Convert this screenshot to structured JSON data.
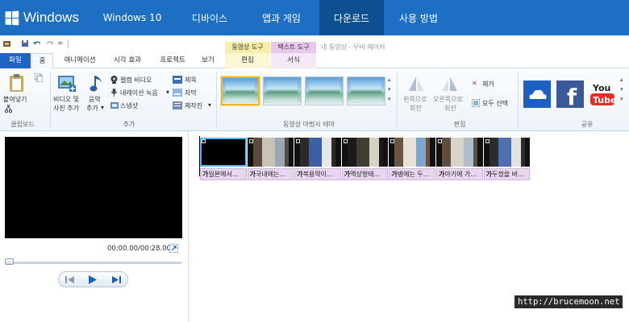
{
  "site_nav": {
    "brand": "Windows",
    "items": [
      {
        "label": "Windows 10"
      },
      {
        "label": "디바이스"
      },
      {
        "label": "앱과 게임"
      },
      {
        "label": "다운로드",
        "active": true
      },
      {
        "label": "사용 방법"
      }
    ],
    "color": "#1c6fc3",
    "active_color": "#0e4f92"
  },
  "app": {
    "contextual_video_tools": "동영상 도구",
    "contextual_text_tools": "텍스트 도구",
    "window_title": "내 동영상 - 무비 메이커",
    "qa_more": "="
  },
  "tabs": {
    "file": "파일",
    "home": "홈",
    "animation": "애니메이션",
    "visual_effects": "시각 효과",
    "project": "프로젝트",
    "view": "보기",
    "edit": "편집",
    "format": "서식"
  },
  "ribbon": {
    "clipboard": {
      "paste": "붙여넣기",
      "group": "클립보드"
    },
    "add": {
      "add_videos_line1": "비디오 및",
      "add_videos_line2": "사진 추가",
      "add_music_line1": "음악",
      "add_music_line2": "추가",
      "webcam": "웹캠 비디오",
      "narration": "내레이션 녹음",
      "snapshot": "스냅샷",
      "title": "제목",
      "caption": "자막",
      "credits": "제작진",
      "group": "추가"
    },
    "themes": {
      "group": "동영상 마법사 테마"
    },
    "editing": {
      "rotate_left_line1": "왼쪽으로",
      "rotate_left_line2": "회전",
      "rotate_right_line1": "오른쪽으로",
      "rotate_right_line2": "회전",
      "remove": "제거",
      "select_all": "모두 선택",
      "group": "편집"
    },
    "share": {
      "group": "공유",
      "youtube_line1": "You",
      "youtube_line2": "Tube"
    }
  },
  "preview": {
    "time": "00:00.00/00:28.00"
  },
  "storyboard": {
    "clips": [
      {
        "caption": "일본에서..."
      },
      {
        "caption": "국내에는..."
      },
      {
        "caption": "복용약이..."
      },
      {
        "caption": "액상형태..."
      },
      {
        "caption": "병에는 두..."
      },
      {
        "caption": "아기에 가..."
      },
      {
        "caption": "두껑을 바..."
      }
    ],
    "caption_glyph": "가"
  },
  "watermark": "http://brucemoon.net"
}
